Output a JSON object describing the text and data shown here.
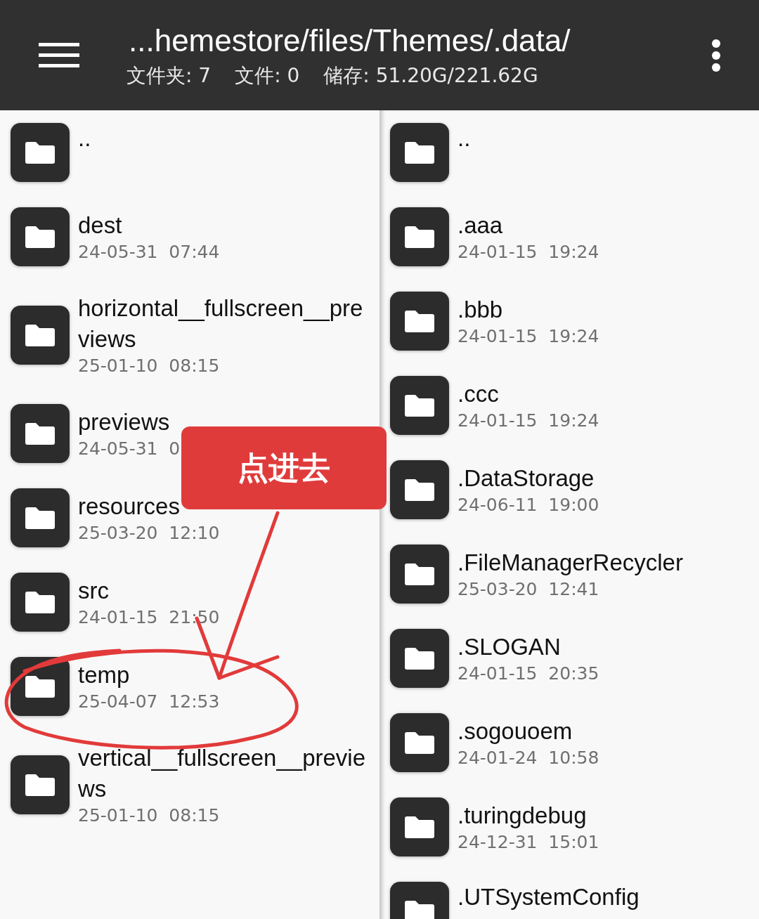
{
  "header": {
    "path": "...hemestore/files/Themes/.data/",
    "stats": [
      "文件夹: 7",
      "文件: 0",
      "储存: 51.20G/221.62G"
    ]
  },
  "panes": [
    {
      "items": [
        {
          "name": ".."
        },
        {
          "name": "dest",
          "modified": "24-05-31  07:44"
        },
        {
          "name": "horizontal__fullscreen__previews",
          "modified": "25-01-10  08:15"
        },
        {
          "name": "previews",
          "modified": "24-05-31  0"
        },
        {
          "name": "resources",
          "modified": "25-03-20  12:10"
        },
        {
          "name": "src",
          "modified": "24-01-15  21:50"
        },
        {
          "name": "temp",
          "modified": "25-04-07  12:53"
        },
        {
          "name": "vertical__fullscreen__previews",
          "modified": "25-01-10  08:15"
        }
      ]
    },
    {
      "items": [
        {
          "name": ".."
        },
        {
          "name": ".aaa",
          "modified": "24-01-15  19:24"
        },
        {
          "name": ".bbb",
          "modified": "24-01-15  19:24"
        },
        {
          "name": ".ccc",
          "modified": "24-01-15  19:24"
        },
        {
          "name": ".DataStorage",
          "modified": "24-06-11  19:00"
        },
        {
          "name": ".FileManagerRecycler",
          "modified": "25-03-20  12:41"
        },
        {
          "name": ".SLOGAN",
          "modified": "24-01-15  20:35"
        },
        {
          "name": ".sogouoem",
          "modified": "24-01-24  10:58"
        },
        {
          "name": ".turingdebug",
          "modified": "24-12-31  15:01"
        },
        {
          "name": ".UTSystemConfig"
        }
      ]
    }
  ],
  "annotation": {
    "callout": "点进去"
  }
}
